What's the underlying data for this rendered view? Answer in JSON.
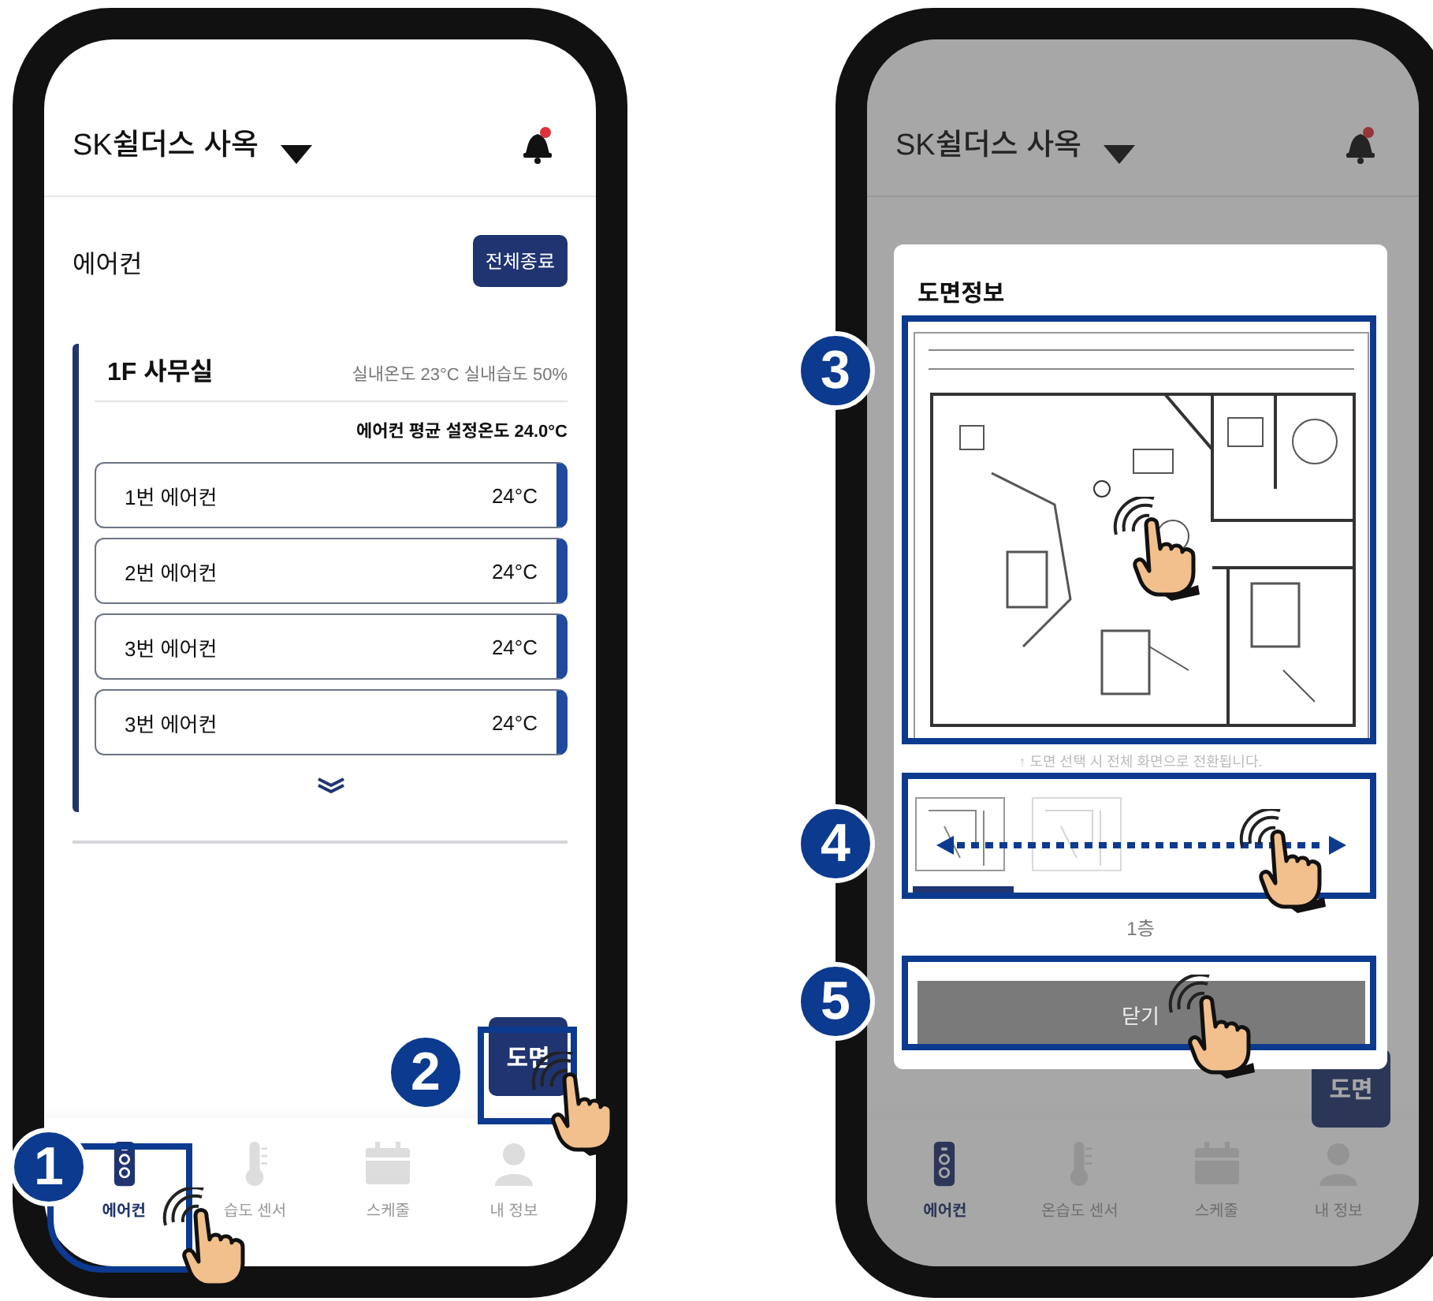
{
  "phones": [
    {
      "dimmed": false,
      "header": {
        "title": "SK쉴더스 사옥",
        "notification": true
      },
      "section_title": "에어컨",
      "stop_all_button": "전체종료",
      "room": {
        "name": "1F 사무실",
        "readings": "실내온도 23°C  실내습도 50%",
        "average": "에어컨 평균 설정온도 24.0°C",
        "units": [
          {
            "name": "1번 에어컨",
            "temp": "24°C"
          },
          {
            "name": "2번 에어컨",
            "temp": "24°C"
          },
          {
            "name": "3번 에어컨",
            "temp": "24°C"
          },
          {
            "name": "3번 에어컨",
            "temp": "24°C"
          }
        ]
      },
      "floor_plan_button": "도면",
      "tabs": [
        {
          "label": "에어컨",
          "selected": true,
          "kind": "ac"
        },
        {
          "label": "습도 센서",
          "selected": false,
          "kind": "thermo"
        },
        {
          "label": "스케줄",
          "selected": false,
          "kind": "calendar"
        },
        {
          "label": "내 정보",
          "selected": false,
          "kind": "person"
        }
      ],
      "steps": [
        {
          "number": "1",
          "kind": "tab"
        },
        {
          "number": "2",
          "kind": "plan_button"
        }
      ]
    },
    {
      "dimmed": true,
      "header": {
        "title": "SK쉴더스 사옥",
        "notification": true
      },
      "floor_plan_button": "도면",
      "tabs": [
        {
          "label": "에어컨",
          "selected": true,
          "kind": "ac"
        },
        {
          "label": "온습도 센서",
          "selected": false,
          "kind": "thermo"
        },
        {
          "label": "스케줄",
          "selected": false,
          "kind": "calendar"
        },
        {
          "label": "내 정보",
          "selected": false,
          "kind": "person"
        }
      ],
      "modal": {
        "title": "도면정보",
        "hint": "↑ 도면 선택 시 전체 화면으로 전환됩니다.",
        "thumbnails": [
          {
            "selected": true
          },
          {
            "selected": false
          }
        ],
        "floor_label": "1층",
        "close_button": "닫기"
      },
      "steps": [
        {
          "number": "3",
          "kind": "plan_image"
        },
        {
          "number": "4",
          "kind": "floor_strip"
        },
        {
          "number": "5",
          "kind": "close_button"
        }
      ]
    }
  ]
}
